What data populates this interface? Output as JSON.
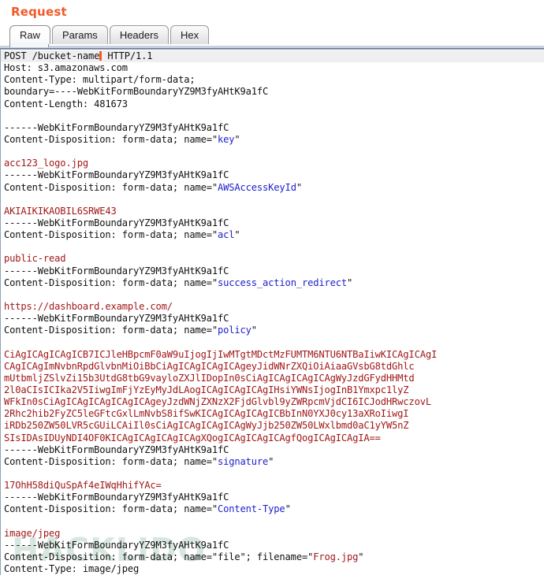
{
  "panel": {
    "title": "Request",
    "watermark": "HACKLIDO"
  },
  "tabs": [
    {
      "label": "Raw",
      "active": true
    },
    {
      "label": "Params",
      "active": false
    },
    {
      "label": "Headers",
      "active": false
    },
    {
      "label": "Hex",
      "active": false
    }
  ],
  "colors": {
    "title_orange": "#f05a28",
    "param_name_blue": "#2020d0",
    "param_value_red": "#a01818",
    "body_text": "#111111",
    "current_line_highlight": "#efefef",
    "caret": "#f05a28"
  },
  "request": {
    "method": "POST",
    "path": "/bucket-name",
    "http_version": "HTTP/1.1",
    "boundary_marker": "------WebKitFormBoundaryYZ9M3fyAHtK9a1fC",
    "headers": [
      "Host: s3.amazonaws.com",
      "Content-Type: multipart/form-data;",
      "boundary=----WebKitFormBoundaryYZ9M3fyAHtK9a1fC",
      "Content-Length: 481673"
    ],
    "content_disposition_prefix": "Content-Disposition: form-data; name=",
    "parts": [
      {
        "name": "key",
        "value": "acc123_logo.jpg"
      },
      {
        "name": "AWSAccessKeyId",
        "value": "AKIAIKIKAOBIL6SRWE43"
      },
      {
        "name": "acl",
        "value": "public-read"
      },
      {
        "name": "success_action_redirect",
        "value": "https://dashboard.example.com/"
      },
      {
        "name": "policy",
        "value": ""
      },
      {
        "name": "signature",
        "value": "17OhH58diQuSpAf4eIWqHhifYAc="
      },
      {
        "name": "Content-Type",
        "value": "image/jpeg"
      }
    ],
    "policy_base64": [
      "CiAgICAgICAgICB7ICJleHBpcmF0aW9uIjogIjIwMTgtMDctMzFUMTM6NTU6NTBaIiwKICAgICAgI",
      "CAgICAgImNvbnRpdGlvbnMiOiBbCiAgICAgICAgICAgeyJidWNrZXQiOiAiaaGVsbG8tdGhlc",
      "mUtbmljZSlvZi15b3UtdG8tbG9vayloZXJlIDopIn0sCiAgICAgICAgICAgWyJzdGFydHHMtd",
      "2l0aCIsICIka2V5IiwgImFjYzEyMyJdLAogICAgICAgICAgIHsiYWNsIjogInB1Ymxpc1lyZ",
      "WFkIn0sCiAgICAgICAgICAgICAgeyJzdWNjZXNzX2FjdGlvbl9yZWRpcmVjdCI6ICJodHRwczovL",
      "2Rhc2hib2FyZC5leGFtcGxlLmNvbS8ifSwKICAgICAgICAgICBbInN0YXJ0cy13aXRoIiwgI",
      "iRDb250ZW50LVR5cGUiLCAiIl0sCiAgICAgICAgICAgWyJjb250ZW50LWxlbmd0aC1yYW5nZ",
      "SIsIDAsIDUyNDI4OF0KICAgICAgICAgICAgXQogICAgICAgICAgfQogICAgICAgIA=="
    ],
    "file_part": {
      "disposition": "Content-Disposition: form-data; name=\"file\"; filename=",
      "filename": "Frog.jpg",
      "content_type": "Content-Type: image/jpeg"
    }
  }
}
